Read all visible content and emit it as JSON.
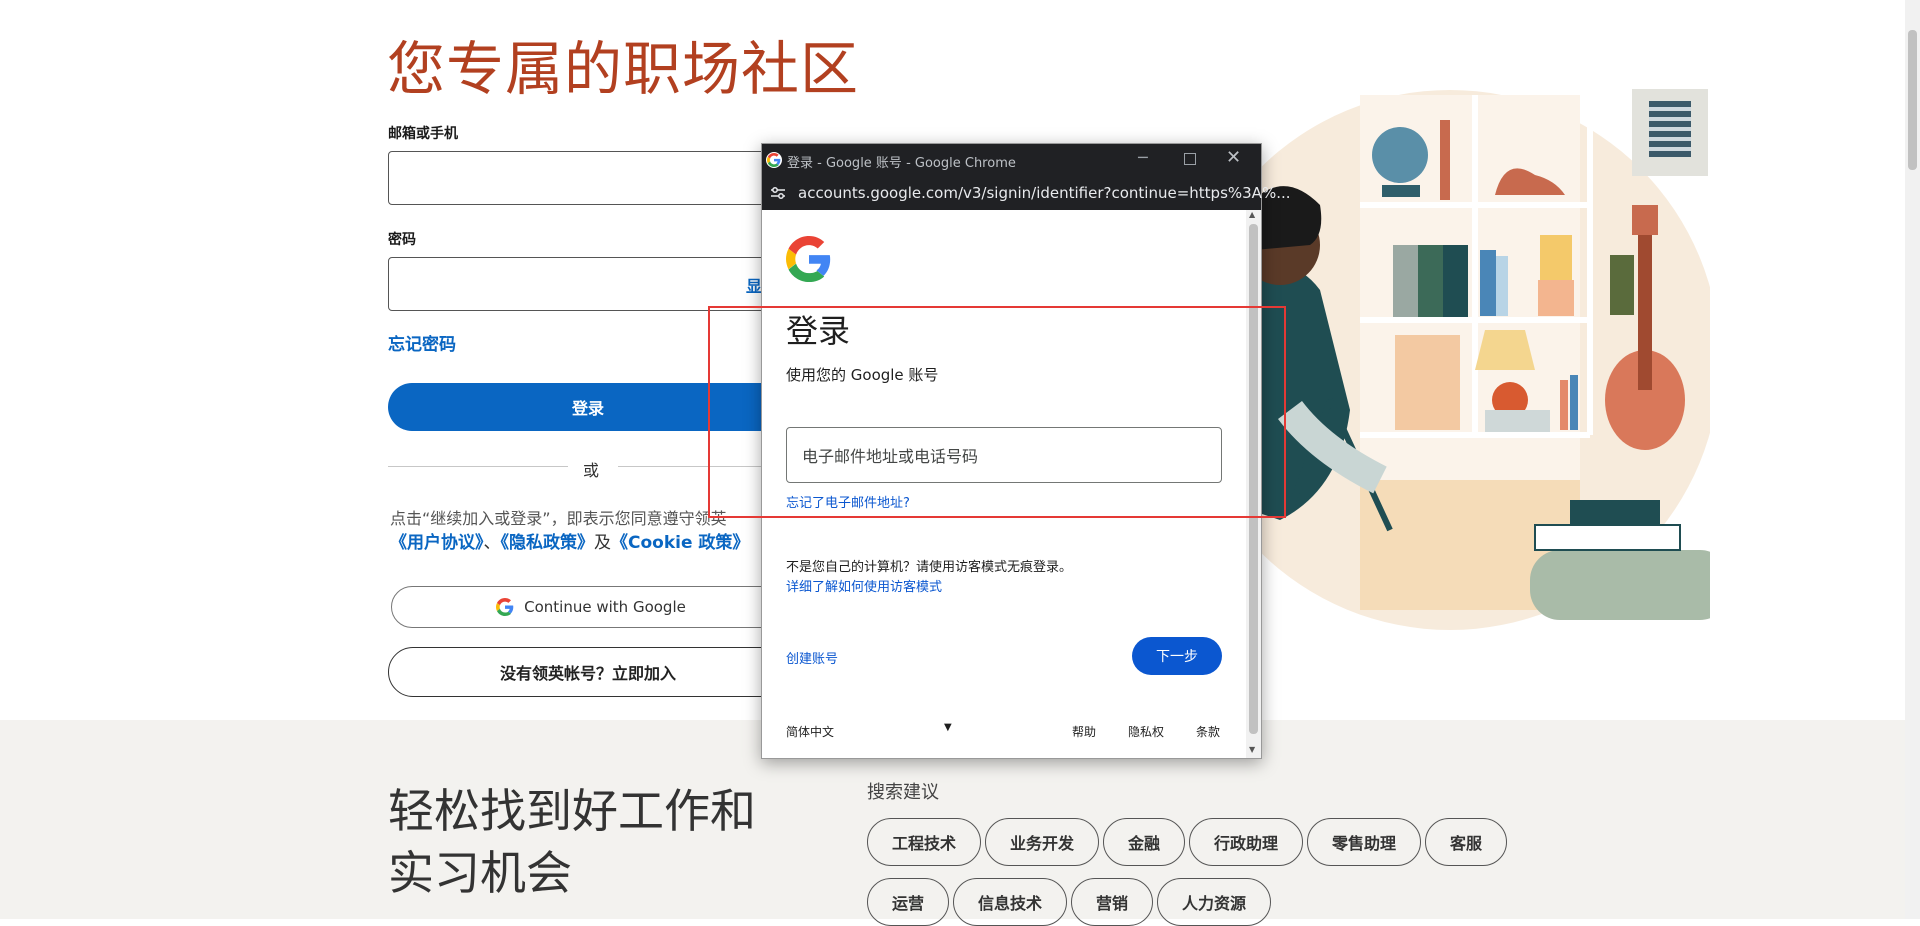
{
  "page": {
    "hero_title": "您专属的职场社区",
    "email_label": "邮箱或手机",
    "password_label": "密码",
    "show_password": "显",
    "forgot_password": "忘记密码",
    "signin_button": "登录",
    "or_text": "或",
    "terms_line1": "点击“继续加入或登录”，即表示您同意遵守领英",
    "terms_user_agreement": "《用户协议》",
    "terms_sep1": "、",
    "terms_privacy": "《隐私政策》",
    "terms_and": "及",
    "terms_cookie": "《Cookie 政策》",
    "google_continue": "Continue with Google",
    "join_now": "没有领英帐号？立即加入",
    "jobs_title_line1": "轻松找到好工作和",
    "jobs_title_line2": "实习机会",
    "search_suggestions_label": "搜索建议",
    "chips_row1": [
      "工程技术",
      "业务开发",
      "金融",
      "行政助理",
      "零售助理",
      "客服"
    ],
    "chips_row2": [
      "运营",
      "信息技术",
      "营销",
      "人力资源"
    ]
  },
  "popup": {
    "window_title": "登录 - Google 账号 - Google Chrome",
    "url": "accounts.google.com/v3/signin/identifier?continue=https%3A%...",
    "heading": "登录",
    "subheading": "使用您的 Google 账号",
    "email_placeholder": "电子邮件地址或电话号码",
    "forgot_email": "忘记了电子邮件地址?",
    "guest_notice": "不是您自己的计算机？请使用访客模式无痕登录。",
    "guest_learn_more": "详细了解如何使用访客模式",
    "create_account": "创建账号",
    "next_button": "下一步",
    "language": "简体中文",
    "footer_help": "帮助",
    "footer_privacy": "隐私权",
    "footer_terms": "条款"
  },
  "colors": {
    "linkedin_blue": "#0a66c2",
    "hero_orange": "#b24020",
    "google_blue": "#0b57d0",
    "annotation_red": "#e53935"
  }
}
